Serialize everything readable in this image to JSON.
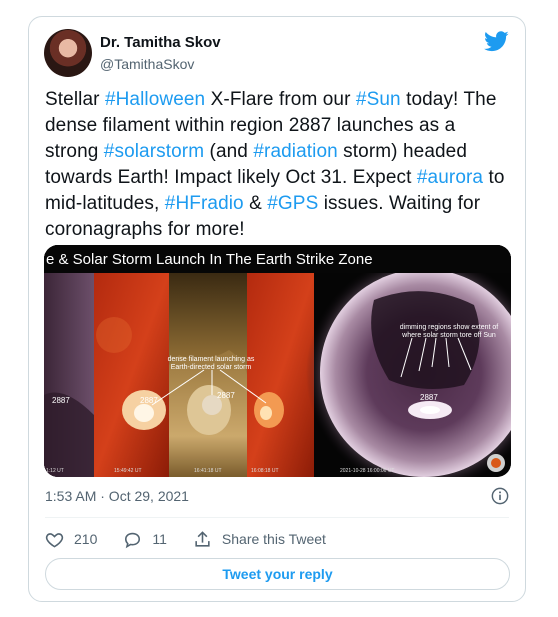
{
  "author": {
    "name": "Dr. Tamitha Skov",
    "handle": "@TamithaSkov"
  },
  "tweet": {
    "segments": [
      {
        "text": "Stellar ",
        "hl": false
      },
      {
        "text": "#Halloween",
        "hl": true
      },
      {
        "text": " X-Flare from our ",
        "hl": false
      },
      {
        "text": "#Sun",
        "hl": true
      },
      {
        "text": " today! The dense filament within region 2887 launches as a strong ",
        "hl": false
      },
      {
        "text": "#solarstorm",
        "hl": true
      },
      {
        "text": " (and ",
        "hl": false
      },
      {
        "text": "#radiation",
        "hl": true
      },
      {
        "text": " storm) headed towards Earth! Impact likely Oct 31. Expect ",
        "hl": false
      },
      {
        "text": "#aurora",
        "hl": true
      },
      {
        "text": " to mid-latitudes, ",
        "hl": false
      },
      {
        "text": "#HFradio",
        "hl": true
      },
      {
        "text": " & ",
        "hl": false
      },
      {
        "text": "#GPS",
        "hl": true
      },
      {
        "text": " issues. Waiting for coronagraphs for more!",
        "hl": false
      }
    ]
  },
  "media": {
    "banner": "e & Solar Storm Launch In The Earth Strike Zone",
    "region_label": "2887",
    "annotation_filament": [
      "dense filament launching as",
      "Earth-directed solar storm"
    ],
    "annotation_dimming": [
      "dimming regions show extent of",
      "where solar storm tore off Sun"
    ],
    "panel_times": [
      "1:12 UT",
      "15:49:42 UT",
      "16:41:18 UT",
      "16:08:18 UT",
      "2021-10-28 16:00:06 UT"
    ]
  },
  "timestamp": "1:53 AM · Oct 29, 2021",
  "actions": {
    "likes": "210",
    "replies": "11",
    "share_label": "Share this Tweet"
  },
  "reply_button_label": "Tweet your reply",
  "colors": {
    "accent": "#1d9bf0",
    "muted": "#536471",
    "border": "#cfd9de"
  }
}
